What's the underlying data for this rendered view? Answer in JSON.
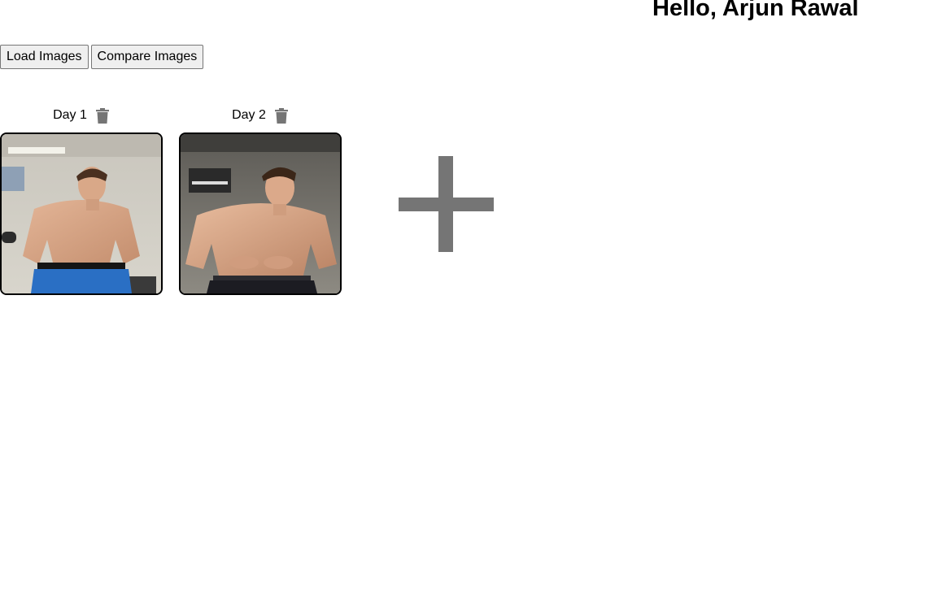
{
  "header": {
    "greeting": "Hello, Arjun Rawal"
  },
  "toolbar": {
    "load_label": "Load Images",
    "compare_label": "Compare Images"
  },
  "gallery": {
    "items": [
      {
        "label": "Day 1",
        "delete_icon": "trash-icon",
        "image": "progress-photo"
      },
      {
        "label": "Day 2",
        "delete_icon": "trash-icon",
        "image": "progress-photo"
      }
    ],
    "add_icon": "plus-icon"
  },
  "colors": {
    "icon_gray": "#757575",
    "photo_border": "#000000"
  }
}
